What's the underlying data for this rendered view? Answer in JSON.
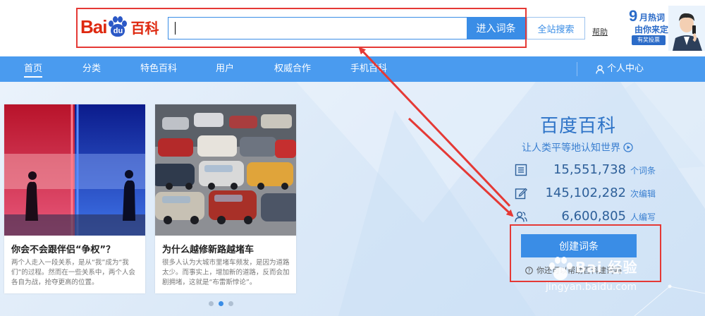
{
  "header": {
    "logo": {
      "bai": "Bai",
      "du": "du",
      "baike": "百科"
    },
    "search": {
      "value": "",
      "placeholder": ""
    },
    "enter_button": "进入词条",
    "site_search_button": "全站搜索",
    "help": "帮助",
    "promo": {
      "num": "9",
      "line1": "月热词",
      "line2": "由你来定",
      "badge": "有奖投票"
    }
  },
  "nav": {
    "items": [
      {
        "label": "首页",
        "active": true
      },
      {
        "label": "分类"
      },
      {
        "label": "特色百科"
      },
      {
        "label": "用户"
      },
      {
        "label": "权威合作"
      },
      {
        "label": "手机百科"
      }
    ],
    "user_center": "个人中心"
  },
  "cards": [
    {
      "title": "你会不会跟伴侣“争权”？",
      "desc": "两个人走入一段关系，是从“我”成为“我们”的过程。然而在一些关系中，两个人会各自为战，抢夺更高的位置。"
    },
    {
      "title": "为什么越修新路越堵车",
      "desc": "很多人认为大城市里堵车频发，是因为道路太少。而事实上，增加新的道路，反而会加剧拥堵，这就是“布雷斯悖论”。"
    }
  ],
  "carousel": {
    "active_index": 1,
    "count": 3
  },
  "baike": {
    "title": "百度百科",
    "slogan": "让人类平等地认知世界",
    "stats": [
      {
        "icon": "entries-icon",
        "value": "15,551,738",
        "unit": "个词条"
      },
      {
        "icon": "edit-icon",
        "value": "145,102,282",
        "unit": "次编辑"
      },
      {
        "icon": "users-icon",
        "value": "6,600,805",
        "unit": "人编写"
      }
    ],
    "create_button": "创建词条",
    "create_hint": "你还可以帮助百科建词吗"
  },
  "watermark": {
    "text": "Bai 经验",
    "url": "jingyan.baidu.com"
  },
  "colors": {
    "accent": "#3a8de6",
    "nav": "#4a9bef",
    "annotation": "#e53935",
    "logo_red": "#de2910",
    "logo_blue": "#2b58c6"
  }
}
